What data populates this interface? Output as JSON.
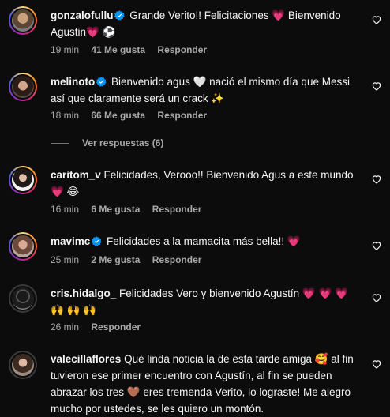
{
  "comments": [
    {
      "username": "gonzalofullu",
      "text": " Grande Verito!! Felicitaciones 💗 Bienvenido Agustin💗 ⚽",
      "time": "19 min",
      "likes": "41 Me gusta",
      "reply": "Responder"
    },
    {
      "username": "melinoto",
      "text": " Bienvenido agus 🤍 nació el mismo día que Messi así que claramente será un crack ✨",
      "time": "18 min",
      "likes": "66 Me gusta",
      "reply": "Responder"
    },
    {
      "username": "caritom_v",
      "text": " Felicidades, Verooo!! Bienvenido Agus a este mundo 💗 😂",
      "time": "16 min",
      "likes": "6 Me gusta",
      "reply": "Responder"
    },
    {
      "username": "mavimc",
      "text": " Felicidades a la mamacita más bella!! 💗",
      "time": "25 min",
      "likes": "2 Me gusta",
      "reply": "Responder"
    },
    {
      "username": "cris.hidalgo_",
      "text": " Felicidades Vero y bienvenido Agustín 💗 💗 💗 🙌 🙌 🙌",
      "time": "26 min",
      "likes": "",
      "reply": "Responder"
    },
    {
      "username": "valecillaflores",
      "text": " Qué linda noticia la de esta tarde amiga 🥰 al fin tuvieron ese primer encuentro con Agustín, al fin se pueden abrazar los tres 🤎 eres tremenda Verito, lo lograste! Me alegro mucho por ustedes, se les quiero un montón.",
      "time": "",
      "likes": "",
      "reply": ""
    }
  ],
  "view_replies": "Ver respuestas (6)",
  "colors": {
    "background": "#0c0c0c",
    "verified": "#0095f6",
    "muted": "#a8a8a8"
  }
}
